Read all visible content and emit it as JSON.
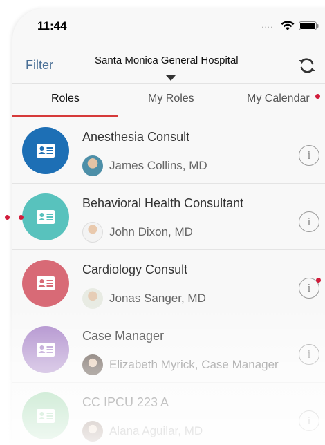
{
  "status_bar": {
    "time": "11:44",
    "signal": "....",
    "icons": [
      "wifi-icon",
      "battery-icon"
    ]
  },
  "navbar": {
    "filter_label": "Filter",
    "hospital": "Santa Monica General Hospital",
    "icons": [
      "caret-down-icon",
      "refresh-icon"
    ]
  },
  "tabs": [
    {
      "label": "Roles",
      "active": true
    },
    {
      "label": "My Roles",
      "active": false
    },
    {
      "label": "My Calendar",
      "active": false
    }
  ],
  "roles": [
    {
      "role": "Anesthesia Consult",
      "person": "James Collins, MD",
      "color": "#1d6fb5",
      "icon": "id-badge-icon"
    },
    {
      "role": "Behavioral Health Consultant",
      "person": "John Dixon, MD",
      "color": "#58c2bd",
      "icon": "id-badge-icon"
    },
    {
      "role": "Cardiology Consult",
      "person": "Jonas Sanger, MD",
      "color": "#d86a76",
      "icon": "id-badge-icon"
    },
    {
      "role": "Case Manager",
      "person": "Elizabeth Myrick, Case Manager",
      "color": "#a884c8",
      "icon": "id-badge-icon"
    },
    {
      "role": "CC IPCU 223 A",
      "person": "Alana Aguilar, MD",
      "color": "#7cc98f",
      "icon": "id-badge-icon"
    }
  ],
  "colors": {
    "accent": "#d63a3a",
    "link": "#4a6f96",
    "marker": "#d11d3c"
  }
}
